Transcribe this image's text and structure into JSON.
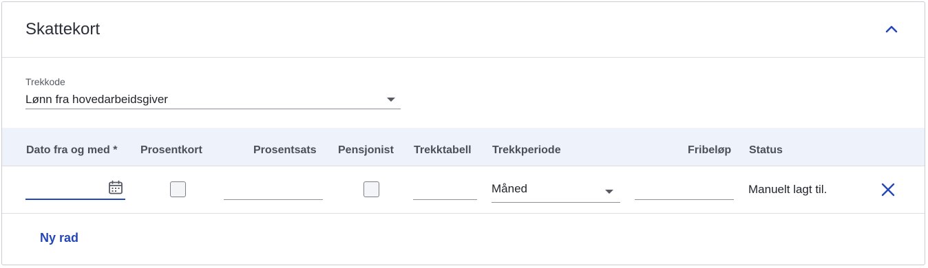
{
  "card": {
    "title": "Skattekort",
    "collapse_icon": "chevron-up-icon"
  },
  "trekkode": {
    "label": "Trekkode",
    "value": "Lønn fra hovedarbeidsgiver"
  },
  "table": {
    "headers": {
      "dato": "Dato fra og med *",
      "prosentkort": "Prosentkort",
      "prosentsats": "Prosentsats",
      "pensjonist": "Pensjonist",
      "trekktabell": "Trekktabell",
      "trekkperiode": "Trekkperiode",
      "fribelop": "Fribeløp",
      "status": "Status"
    },
    "rows": [
      {
        "dato": "",
        "prosentkort": false,
        "prosentsats": "",
        "pensjonist": false,
        "trekktabell": "",
        "trekkperiode": "Måned",
        "fribelop": "",
        "status": "Manuelt lagt til."
      }
    ]
  },
  "actions": {
    "add_row": "Ny rad"
  },
  "colors": {
    "accent": "#2546b8",
    "header_bg": "#eef2fb",
    "border": "#dcdde0"
  }
}
